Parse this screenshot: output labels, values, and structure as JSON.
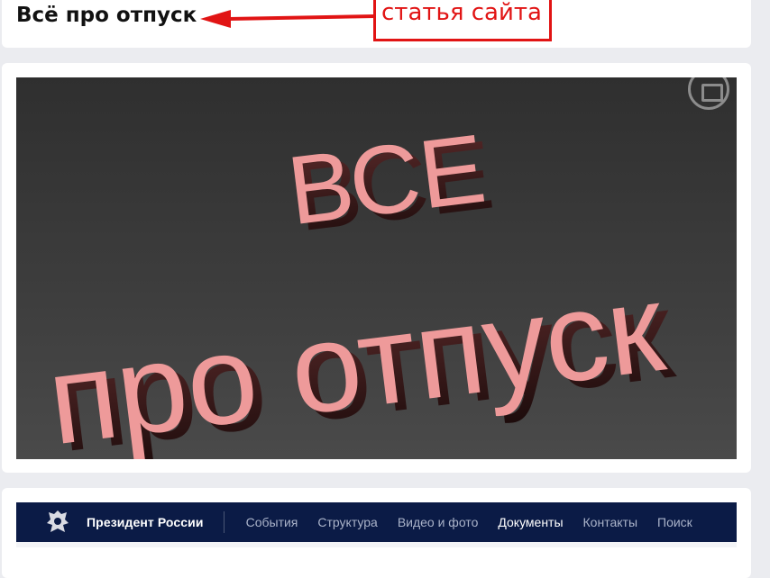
{
  "article": {
    "title": "Всё про отпуск"
  },
  "annotation": {
    "label": "статья сайта",
    "color": "#e11414"
  },
  "promo_image": {
    "line1": "ВСЕ",
    "line2": "про отпуск",
    "text_color": "#ee9a9a"
  },
  "embed": {
    "site_name": "Президент России",
    "nav": [
      {
        "label": "События"
      },
      {
        "label": "Структура"
      },
      {
        "label": "Видео и фото"
      },
      {
        "label": "Документы"
      },
      {
        "label": "Контакты"
      },
      {
        "label": "Поиск"
      }
    ],
    "background": "#0b1b46"
  }
}
